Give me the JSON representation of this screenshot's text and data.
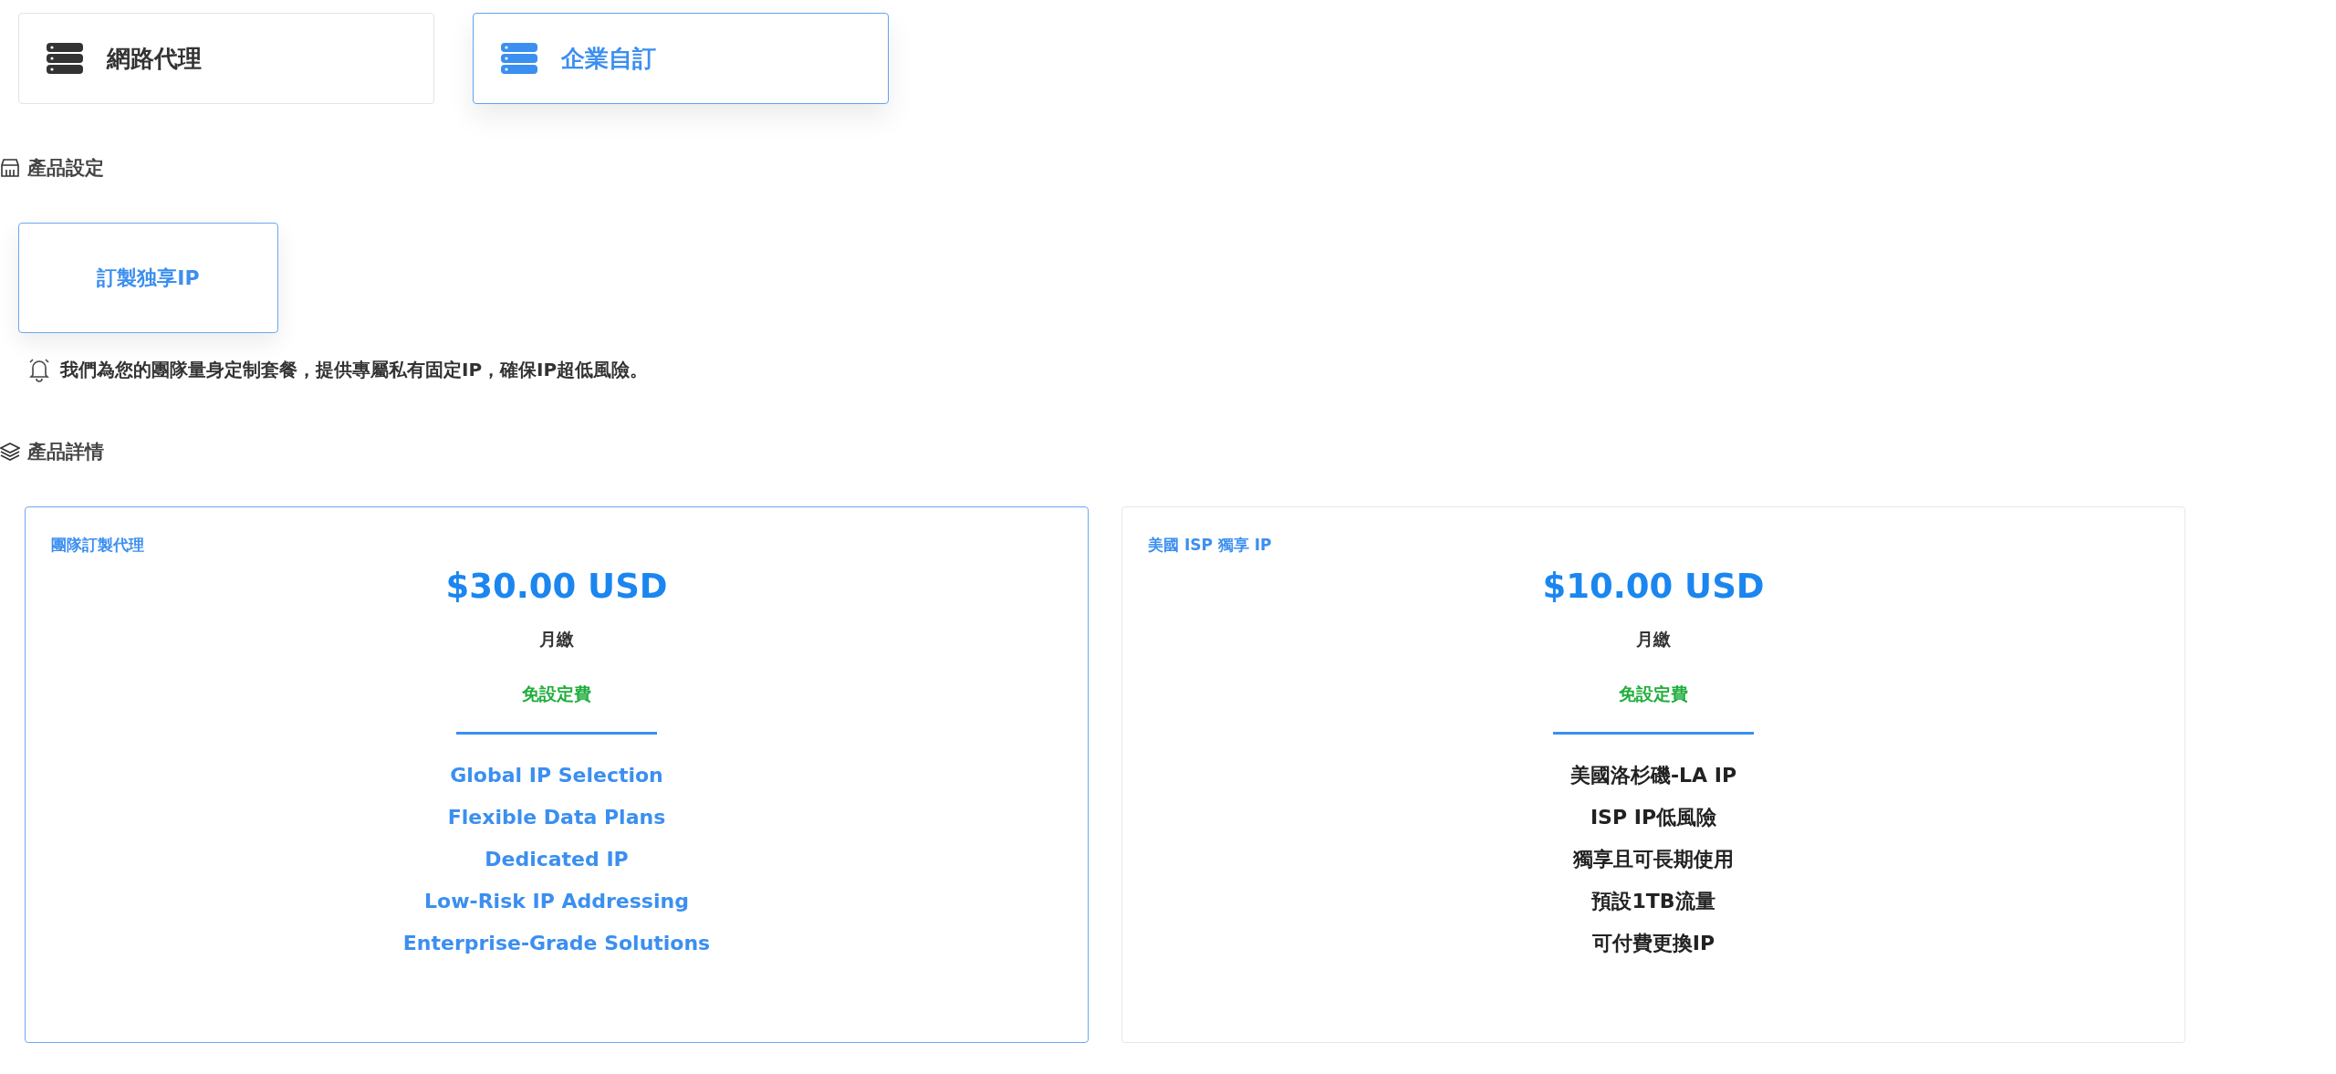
{
  "category_tabs": [
    {
      "label": "網路代理",
      "selected": false
    },
    {
      "label": "企業自訂",
      "selected": true
    }
  ],
  "product_settings": {
    "heading": "產品設定",
    "options": [
      {
        "label": "訂製独享IP",
        "selected": true
      }
    ],
    "notice": "我們為您的團隊量身定制套餐，提供專屬私有固定IP，確保IP超低風險。"
  },
  "product_details": {
    "heading": "產品詳情",
    "plans": [
      {
        "name": "團隊訂製代理",
        "price": "$30.00 USD",
        "billing": "月繳",
        "setup_fee": "免設定費",
        "selected": true,
        "features": [
          "Global IP Selection",
          "Flexible Data Plans",
          "Dedicated IP",
          "Low-Risk IP Addressing",
          "Enterprise-Grade Solutions"
        ]
      },
      {
        "name": "美國 ISP 獨享 IP",
        "price": "$10.00 USD",
        "billing": "月繳",
        "setup_fee": "免設定費",
        "selected": false,
        "features": [
          "美國洛杉磯-LA IP",
          "ISP IP低風險",
          "獨享且可長期使用",
          "預設1TB流量",
          "可付費更換IP"
        ]
      }
    ]
  }
}
